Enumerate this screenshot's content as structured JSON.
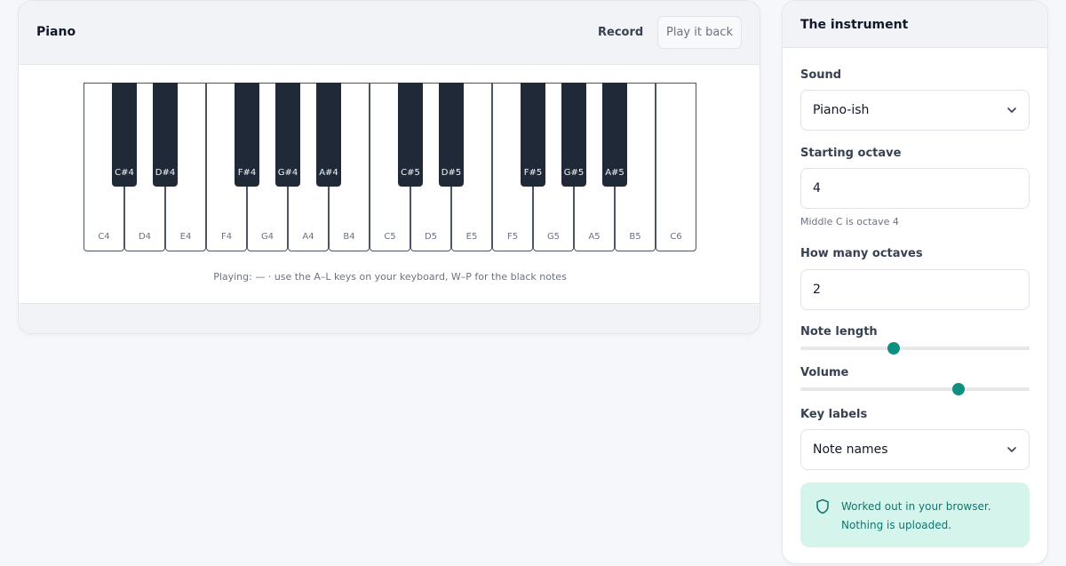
{
  "piano": {
    "title": "Piano",
    "record_label": "Record",
    "play_back_label": "Play it back",
    "status_text": "Playing: — · use the A–L keys on your keyboard, W–P for the black notes",
    "white_keys": [
      "C4",
      "D4",
      "E4",
      "F4",
      "G4",
      "A4",
      "B4",
      "C5",
      "D5",
      "E5",
      "F5",
      "G5",
      "A5",
      "B5",
      "C6"
    ],
    "black_keys": [
      "C#4",
      "D#4",
      "F#4",
      "G#4",
      "A#4",
      "C#5",
      "D#5",
      "F#5",
      "G#5",
      "A#5"
    ]
  },
  "instrument": {
    "title": "The instrument",
    "sound": {
      "label": "Sound",
      "value": "Piano-ish"
    },
    "starting_octave": {
      "label": "Starting octave",
      "value": "4",
      "hint": "Middle C is octave 4"
    },
    "how_many_octaves": {
      "label": "How many octaves",
      "value": "2"
    },
    "note_length": {
      "label": "Note length",
      "level": 0.4
    },
    "volume": {
      "label": "Volume",
      "level": 0.7
    },
    "key_labels": {
      "label": "Key labels",
      "value": "Note names"
    },
    "notice": {
      "line1": "Worked out in your browser.",
      "line2": "Nothing is uploaded."
    }
  },
  "colors": {
    "accent": "#0f8f7f",
    "black_key": "#1f2937",
    "notice_bg": "#d5f5ec"
  },
  "icons": {
    "select": "chevron-down-icon",
    "notice": "shield-icon"
  }
}
